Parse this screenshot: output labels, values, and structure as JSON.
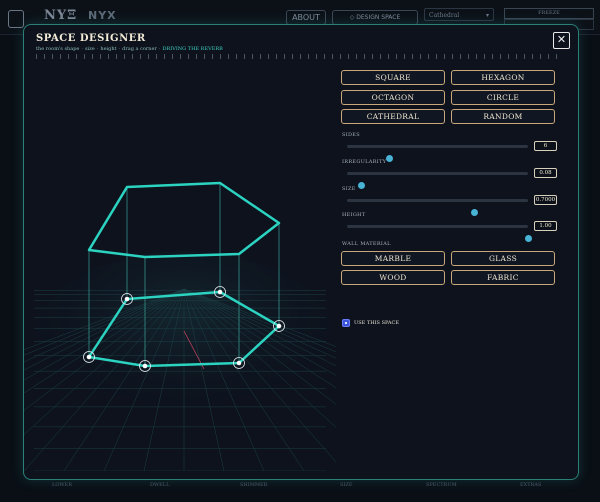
{
  "app": {
    "title": "NYΞ",
    "subtitle": "NYX",
    "about": "ABOUT",
    "design_space": "◇ DESIGN SPACE",
    "preset": "Cathedral",
    "top_button": "FREEZE"
  },
  "modal": {
    "title": "SPACE DESIGNER",
    "subtitle_parts": [
      "the room's shape",
      "size",
      "height",
      "drag a corner"
    ],
    "subtitle_accent": "DRIVING THE REVERB",
    "close": "✕"
  },
  "shapes": [
    "SQUARE",
    "HEXAGON",
    "OCTAGON",
    "CIRCLE",
    "CATHEDRAL",
    "RANDOM"
  ],
  "sliders": {
    "sides": {
      "label": "SIDES",
      "value": "6",
      "fraction": 0.23
    },
    "irregularity": {
      "label": "IRREGULARITY",
      "value": "0.08",
      "fraction": 0.08
    },
    "size": {
      "label": "SIZE",
      "value": "0.7000",
      "fraction": 0.7
    },
    "height": {
      "label": "HEIGHT",
      "value": "1.00",
      "fraction": 1.0
    }
  },
  "wall": {
    "label": "WALL MATERIAL",
    "materials": [
      "MARBLE",
      "GLASS",
      "WOOD",
      "FABRIC"
    ]
  },
  "use_space": {
    "label": "USE THIS SPACE",
    "checked": true
  },
  "footer": [
    "LOWER",
    "DWELL",
    "SHIMMER",
    "SIZE",
    "SPECTRUM",
    "EXTRAS"
  ],
  "colors": {
    "accent": "#2bd3c0",
    "modal_border": "#2a7f76",
    "button_border": "#c9a77a",
    "slider_thumb": "#49b3d6",
    "checkbox": "#3a55d8"
  }
}
